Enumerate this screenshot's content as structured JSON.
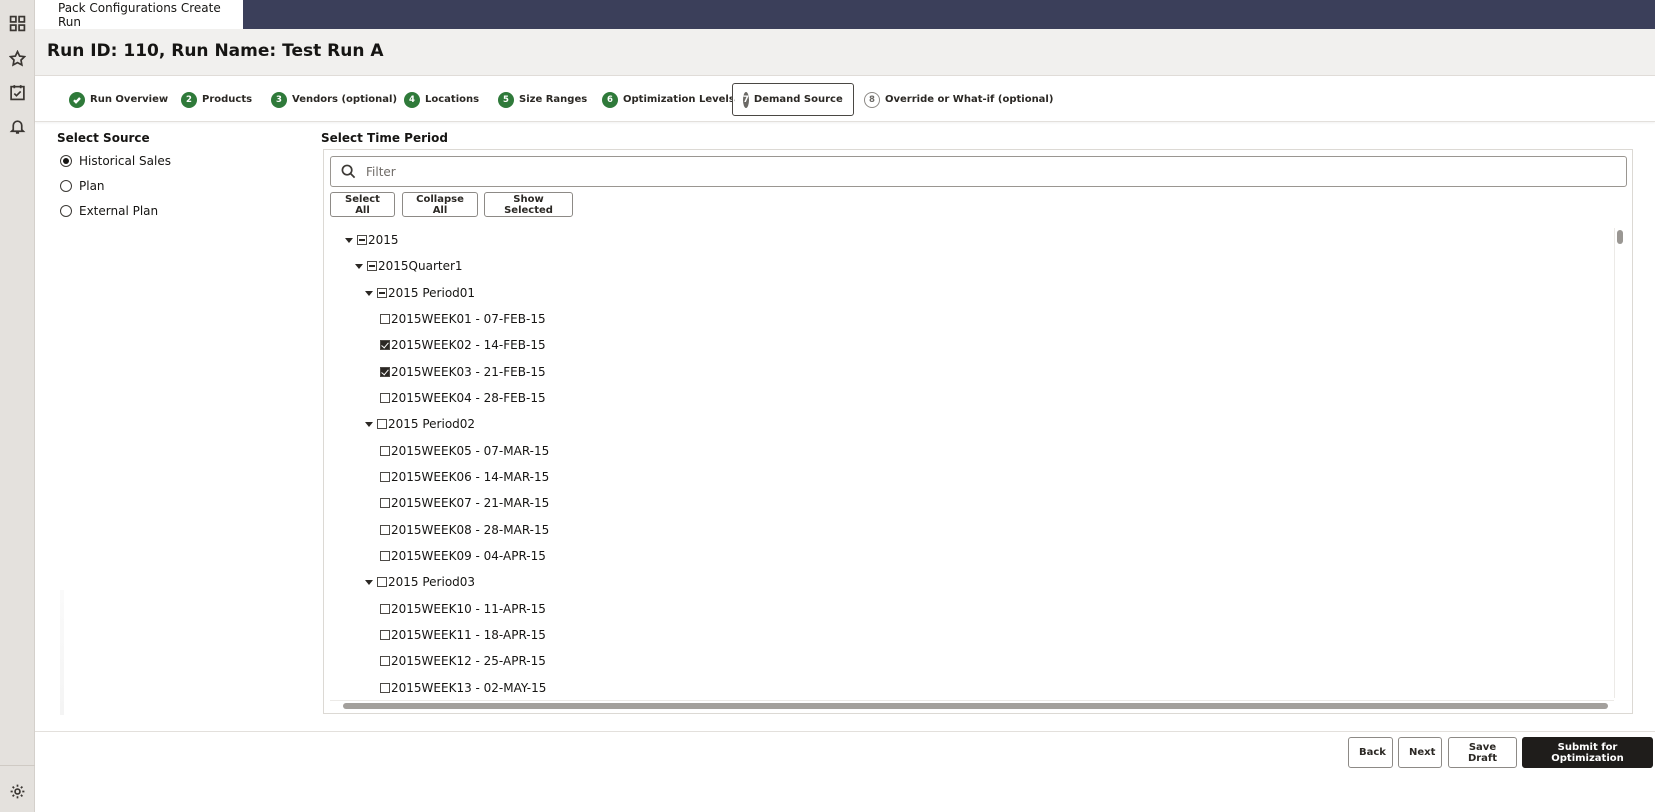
{
  "app": {
    "tab_title": "Pack Configurations Create Run"
  },
  "rail": {
    "icons": [
      "grid-icon",
      "star-icon",
      "checklist-icon",
      "bell-icon",
      "gear-icon"
    ]
  },
  "header": {
    "title": "Run ID: 110, Run Name: Test Run A"
  },
  "stepper": {
    "steps": [
      {
        "num": "",
        "label": "Run Overview",
        "state": "done"
      },
      {
        "num": "2",
        "label": "Products",
        "state": "done"
      },
      {
        "num": "3",
        "label": "Vendors (optional)",
        "state": "done"
      },
      {
        "num": "4",
        "label": "Locations",
        "state": "done"
      },
      {
        "num": "5",
        "label": "Size Ranges",
        "state": "done"
      },
      {
        "num": "6",
        "label": "Optimization Levels",
        "state": "done"
      },
      {
        "num": "7",
        "label": "Demand Source",
        "state": "current"
      },
      {
        "num": "8",
        "label": "Override or What-if (optional)",
        "state": "future"
      }
    ]
  },
  "source": {
    "title": "Select Source",
    "options": [
      {
        "label": "Historical Sales",
        "selected": true
      },
      {
        "label": "Plan",
        "selected": false
      },
      {
        "label": "External Plan",
        "selected": false
      }
    ]
  },
  "time_period": {
    "title": "Select Time Period",
    "filter_placeholder": "Filter",
    "buttons": {
      "select_all": "Select All",
      "collapse_all": "Collapse All",
      "show_selected": "Show Selected"
    },
    "tree": [
      {
        "label": "2015",
        "level": 0,
        "expander": true,
        "check": "minus"
      },
      {
        "label": "2015Quarter1",
        "level": 1,
        "expander": true,
        "check": "minus"
      },
      {
        "label": "2015 Period01",
        "level": 2,
        "expander": true,
        "check": "minus"
      },
      {
        "label": "2015WEEK01 - 07-FEB-15",
        "level": 3,
        "expander": false,
        "check": "none"
      },
      {
        "label": "2015WEEK02 - 14-FEB-15",
        "level": 3,
        "expander": false,
        "check": "checked"
      },
      {
        "label": "2015WEEK03 - 21-FEB-15",
        "level": 3,
        "expander": false,
        "check": "checked"
      },
      {
        "label": "2015WEEK04 - 28-FEB-15",
        "level": 3,
        "expander": false,
        "check": "none"
      },
      {
        "label": "2015 Period02",
        "level": 2,
        "expander": true,
        "check": "none"
      },
      {
        "label": "2015WEEK05 - 07-MAR-15",
        "level": 3,
        "expander": false,
        "check": "none"
      },
      {
        "label": "2015WEEK06 - 14-MAR-15",
        "level": 3,
        "expander": false,
        "check": "none"
      },
      {
        "label": "2015WEEK07 - 21-MAR-15",
        "level": 3,
        "expander": false,
        "check": "none"
      },
      {
        "label": "2015WEEK08 - 28-MAR-15",
        "level": 3,
        "expander": false,
        "check": "none"
      },
      {
        "label": "2015WEEK09 - 04-APR-15",
        "level": 3,
        "expander": false,
        "check": "none"
      },
      {
        "label": "2015 Period03",
        "level": 2,
        "expander": true,
        "check": "none"
      },
      {
        "label": "2015WEEK10 - 11-APR-15",
        "level": 3,
        "expander": false,
        "check": "none"
      },
      {
        "label": "2015WEEK11 - 18-APR-15",
        "level": 3,
        "expander": false,
        "check": "none"
      },
      {
        "label": "2015WEEK12 - 25-APR-15",
        "level": 3,
        "expander": false,
        "check": "none"
      },
      {
        "label": "2015WEEK13 - 02-MAY-15",
        "level": 3,
        "expander": false,
        "check": "none"
      }
    ]
  },
  "footer": {
    "back": "Back",
    "next": "Next",
    "save_draft": "Save Draft",
    "submit": "Submit for Optimization"
  }
}
